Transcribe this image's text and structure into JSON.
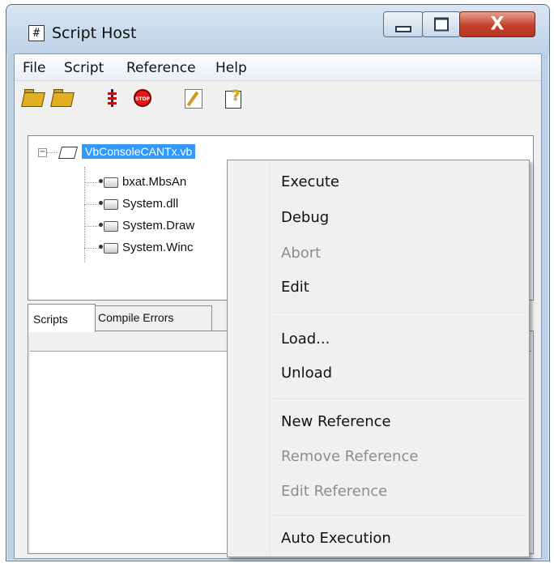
{
  "window": {
    "title": "Script Host",
    "app_icon": "#",
    "close_glyph": "X"
  },
  "menu": [
    "File",
    "Script",
    "Reference",
    "Help"
  ],
  "toolbar": {
    "icons": [
      "open-folder-icon",
      "open-folder-alt-icon",
      "bolt-icon",
      "stop-icon",
      "edit-icon",
      "help-icon"
    ],
    "stop_text": "STOP"
  },
  "tree": {
    "root_label": "VbConsoleCANTx.vb",
    "children": [
      "bxat.MbsAn",
      "System.dll",
      "System.Draw",
      "System.Winc"
    ]
  },
  "tabs": [
    "Scripts",
    "Compile Errors"
  ],
  "context_menu": [
    {
      "label": "Execute",
      "enabled": true
    },
    {
      "label": "Debug",
      "enabled": true
    },
    {
      "label": "Abort",
      "enabled": false
    },
    {
      "label": "Edit",
      "enabled": true
    },
    {
      "label": "Load...",
      "enabled": true
    },
    {
      "label": "Unload",
      "enabled": true
    },
    {
      "label": "New Reference",
      "enabled": true
    },
    {
      "label": "Remove Reference",
      "enabled": false
    },
    {
      "label": "Edit Reference",
      "enabled": false
    },
    {
      "label": "Auto Execution",
      "enabled": true
    }
  ],
  "colors": {
    "selection": "#3399ff",
    "close_button": "#c2422a",
    "disabled_text": "#8d8d8d"
  }
}
